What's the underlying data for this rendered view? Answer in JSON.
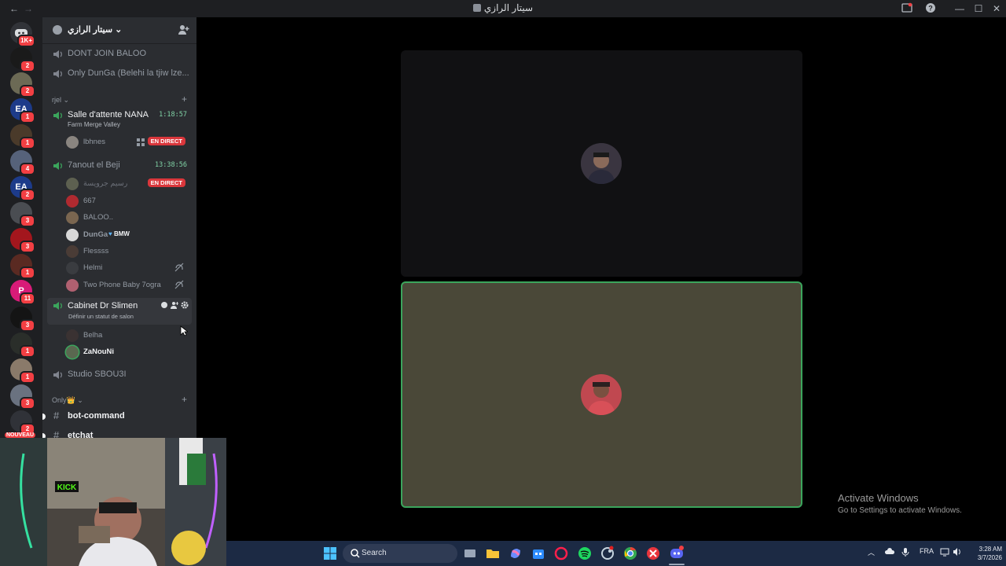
{
  "titlebar": {
    "title": "سيتار الرازي",
    "back": "←",
    "forward": "→",
    "minimize": "—",
    "maximize": "☐",
    "close": "✕"
  },
  "rail": {
    "servers": [
      {
        "badge": "1K+",
        "text": "",
        "color": "#313338"
      },
      {
        "badge": "2",
        "text": "",
        "color": "#1a1a1a"
      },
      {
        "badge": "2",
        "text": "",
        "color": "#6c6a55"
      },
      {
        "badge": "1",
        "text": "EA",
        "color": "#1d3b8a"
      },
      {
        "badge": "1",
        "text": "",
        "color": "#4a3a2a"
      },
      {
        "badge": "4",
        "text": "",
        "color": "#56627a"
      },
      {
        "badge": "2",
        "text": "EA",
        "color": "#1d3b8a"
      },
      {
        "badge": "3",
        "text": "",
        "color": "#4a4d52"
      },
      {
        "badge": "3",
        "text": "",
        "color": "#a3161d"
      },
      {
        "badge": "1",
        "text": "",
        "color": "#5a2a22"
      },
      {
        "badge": "11",
        "text": "P",
        "color": "#d81b78"
      },
      {
        "badge": "3",
        "text": "",
        "color": "#141414"
      },
      {
        "badge": "1",
        "text": "",
        "color": "#2a2e2a"
      },
      {
        "badge": "1",
        "text": "",
        "color": "#8a7a6a"
      },
      {
        "badge": "3",
        "text": "",
        "color": "#6a7280"
      },
      {
        "badge": "2",
        "text": "",
        "color": "#303238"
      }
    ],
    "new_label": "NOUVEAU"
  },
  "sidebar": {
    "guild_name": "سيتار الرازي",
    "top_channels": [
      {
        "name": "DONT JOIN BALOO"
      },
      {
        "name": "Only DunGa (Belehi la tjiw lze..."
      }
    ],
    "category_rjel": "rjel",
    "category_only": "Only👑",
    "voice_channels": {
      "salle": {
        "name": "Salle d'attente NANA",
        "timer": "1:18:57",
        "status": "Farm Merge Valley"
      },
      "tanout": {
        "name": "7anout el Beji",
        "timer": "13:38:56"
      },
      "cabinet": {
        "name": "Cabinet Dr Slimen",
        "status": "Définir un statut de salon"
      },
      "studio": {
        "name": "Studio SBOU3I"
      }
    },
    "users": {
      "lbhnes": "lbhnes",
      "rasim": "رسيم جرويسة",
      "u667": "667",
      "baloo": "BALOO..",
      "dunga": "DunGa",
      "dunga_tag": "BMW",
      "flessss": "Flessss",
      "helmi": "Helmi",
      "twophone": "Two Phone Baby 7ogra",
      "belha": "Belha",
      "zanouni": "ZaNouNi"
    },
    "live_label": "EN DIRECT",
    "text_channels": [
      {
        "name": "bot-command"
      },
      {
        "name": "etchat"
      }
    ]
  },
  "watermark": {
    "line1": "Activate Windows",
    "line2": "Go to Settings to activate Windows."
  },
  "taskbar": {
    "search_placeholder": "Search",
    "lang": "FRA",
    "time": "3:28 AM",
    "date": "3/7/2026"
  }
}
